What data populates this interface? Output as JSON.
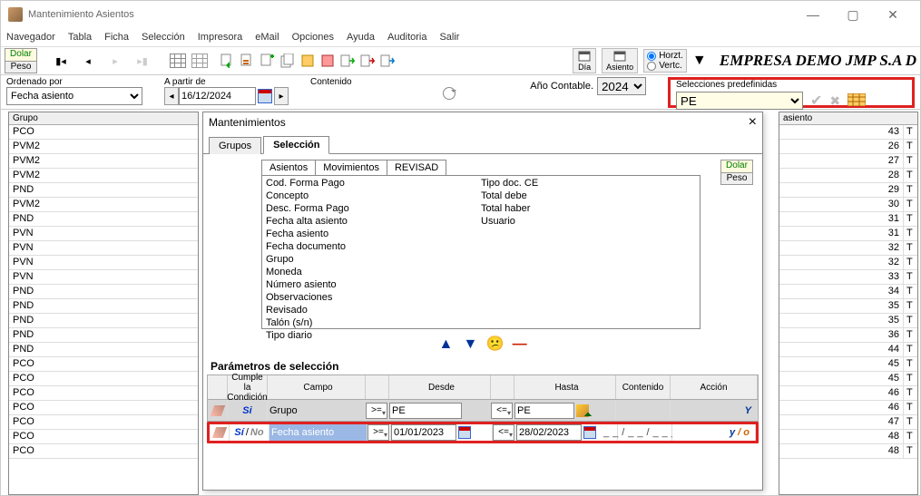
{
  "window": {
    "title": "Mantenimiento Asientos"
  },
  "menu": [
    "Navegador",
    "Tabla",
    "Ficha",
    "Selección",
    "Impresora",
    "eMail",
    "Opciones",
    "Ayuda",
    "Auditoria",
    "Salir"
  ],
  "currency": {
    "dolar": "Dolar",
    "peso": "Peso"
  },
  "dia_label": "Día",
  "asiento_label": "Asiento",
  "orient": {
    "h": "Horzt.",
    "v": "Vertc."
  },
  "company": "EMPRESA DEMO JMP S.A D",
  "ordenado_label": "Ordenado por",
  "ordenado_value": "Fecha asiento",
  "apartir_label": "A partir de",
  "apartir_value": "16/12/2024",
  "contenido_label": "Contenido",
  "ano_label": "Año Contable.",
  "ano_value": "2024",
  "predef_label": "Selecciones predefinidas",
  "predef_value": "PE",
  "left_header": "Grupo",
  "left_rows": [
    "PCO",
    "PVM2",
    "PVM2",
    "PVM2",
    "PND",
    "PVM2",
    "PND",
    "PVN",
    "PVN",
    "PVN",
    "PVN",
    "PND",
    "PND",
    "PND",
    "PND",
    "PND",
    "PCO",
    "PCO",
    "PCO",
    "PCO",
    "PCO",
    "PCO",
    "PCO"
  ],
  "right_header_a": "asiento",
  "right_header_b": "",
  "right_rows": [
    [
      43,
      "T"
    ],
    [
      26,
      "T"
    ],
    [
      27,
      "T"
    ],
    [
      28,
      "T"
    ],
    [
      29,
      "T"
    ],
    [
      30,
      "T"
    ],
    [
      31,
      "T"
    ],
    [
      31,
      "T"
    ],
    [
      32,
      "T"
    ],
    [
      32,
      "T"
    ],
    [
      33,
      "T"
    ],
    [
      34,
      "T"
    ],
    [
      35,
      "T"
    ],
    [
      35,
      "T"
    ],
    [
      36,
      "T"
    ],
    [
      44,
      "T"
    ],
    [
      45,
      "T"
    ],
    [
      45,
      "T"
    ],
    [
      46,
      "T"
    ],
    [
      46,
      "T"
    ],
    [
      47,
      "T"
    ],
    [
      48,
      "T"
    ],
    [
      48,
      "T"
    ]
  ],
  "dialog": {
    "title": "Mantenimientos",
    "tabs": [
      "Grupos",
      "Selección"
    ],
    "subtabs": [
      "Asientos",
      "Movimientos",
      "REVISAD"
    ],
    "fields_col1": [
      "Cod. Forma Pago",
      "Concepto",
      "Desc. Forma Pago",
      "Fecha alta asiento",
      "Fecha asiento",
      "Fecha documento",
      "Grupo",
      "Moneda",
      "Número asiento",
      "Observaciones",
      "Revisado",
      "Talón (s/n)",
      "Tipo diario"
    ],
    "fields_col2": [
      "Tipo doc. CE",
      "Total debe",
      "Total haber",
      "Usuario"
    ],
    "params_label": "Parámetros de selección",
    "head": {
      "b": "Cumple la Condición",
      "c": "Campo",
      "e": "Desde",
      "g": "Hasta",
      "h": "Contenido",
      "i": "Acción"
    },
    "row1": {
      "si": "Si",
      "campo": "Grupo",
      "op1": ">=",
      "desde": "PE",
      "op2": "<=",
      "hasta": "PE",
      "accion": "Y"
    },
    "row2": {
      "si": "Sí",
      "no": "No",
      "campo": "Fecha asiento",
      "op1": ">=",
      "desde": "01/01/2023",
      "op2": "<=",
      "hasta": "28/02/2023",
      "cont": "__/__/____",
      "accion_y": "y",
      "accion_o": " / o"
    }
  }
}
